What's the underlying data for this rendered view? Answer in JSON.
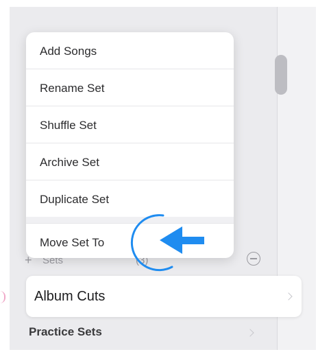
{
  "menu": {
    "items": [
      {
        "label": "Add Songs"
      },
      {
        "label": "Rename Set"
      },
      {
        "label": "Shuffle Set"
      },
      {
        "label": "Archive Set"
      },
      {
        "label": "Duplicate Set"
      },
      {
        "label": "Move Set To"
      }
    ]
  },
  "sets_header": {
    "add_icon": "+",
    "label": "Sets",
    "count": "(3)"
  },
  "list": {
    "album_cuts": "Album Cuts",
    "practice_sets": "Practice Sets"
  },
  "annotation": {
    "color": "#1f8cf0",
    "arrow_icon": "arrow-left-icon",
    "circle_icon": "tap-circle-icon"
  }
}
